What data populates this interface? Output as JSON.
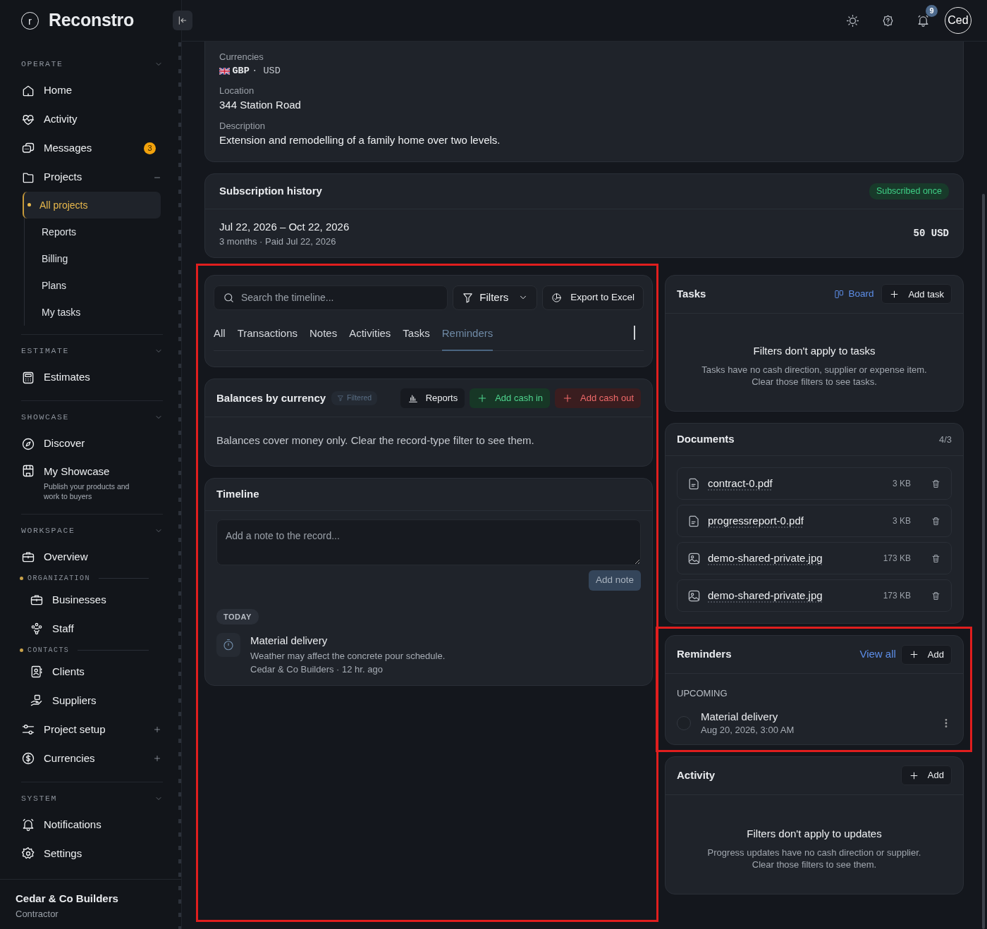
{
  "brand": {
    "mark": "r",
    "name": "Reconstro"
  },
  "topbar": {
    "notifications_count": "9",
    "avatar_text": "Ced"
  },
  "sidebar": {
    "sections": [
      {
        "title": "OPERATE",
        "expanded": true,
        "items": [
          {
            "label": "Home",
            "selected": false
          },
          {
            "label": "Activity",
            "selected": false
          },
          {
            "label": "Messages",
            "selected": false,
            "badge": "3"
          },
          {
            "label": "Projects",
            "selected": false,
            "expanded": true,
            "children": [
              {
                "label": "All projects",
                "selected": true
              },
              {
                "label": "Reports",
                "selected": false
              },
              {
                "label": "Billing",
                "selected": false
              },
              {
                "label": "Plans",
                "selected": false
              },
              {
                "label": "My tasks",
                "selected": false
              }
            ]
          }
        ]
      },
      {
        "title": "ESTIMATE",
        "expanded": true,
        "items": [
          {
            "label": "Estimates",
            "selected": false
          }
        ]
      },
      {
        "title": "SHOWCASE",
        "expanded": true,
        "items": [
          {
            "label": "Discover",
            "selected": false
          },
          {
            "label": "My Showcase",
            "selected": false,
            "description": "Publish your products and work to buyers"
          }
        ]
      },
      {
        "title": "WORKSPACE",
        "expanded": true,
        "items": [
          {
            "label": "Overview",
            "selected": false
          },
          {
            "kind": "group",
            "label": "ORGANIZATION",
            "children": [
              {
                "label": "Businesses",
                "selected": false
              },
              {
                "label": "Staff",
                "selected": false
              }
            ]
          },
          {
            "kind": "group",
            "label": "CONTACTS",
            "children": [
              {
                "label": "Clients",
                "selected": false
              },
              {
                "label": "Suppliers",
                "selected": false
              }
            ]
          },
          {
            "label": "Project setup",
            "selected": false,
            "expanded": false
          },
          {
            "label": "Currencies",
            "selected": false,
            "expanded": false
          }
        ]
      },
      {
        "title": "SYSTEM",
        "expanded": true,
        "items": [
          {
            "label": "Notifications",
            "selected": false
          },
          {
            "label": "Settings",
            "selected": false
          }
        ]
      }
    ],
    "footer": {
      "name": "Cedar & Co Builders",
      "role": "Contractor"
    }
  },
  "details": {
    "fields": [
      {
        "kind": "currency",
        "label": "Currencies",
        "value": "GBP",
        "extra": "· USD"
      },
      {
        "kind": "text",
        "label": "Location",
        "value": "344 Station Road"
      },
      {
        "kind": "text",
        "label": "Description",
        "value": "Extension and remodelling of a family home over two levels."
      }
    ]
  },
  "subscription": {
    "title": "Subscription history",
    "badge": "Subscribed once",
    "period": "Jul 22, 2026 – Oct 22, 2026",
    "meta": "3 months · Paid Jul 22, 2026",
    "amount": "50 USD"
  },
  "timeline_panel": {
    "highlighted": true,
    "search": {
      "placeholder": "Search the timeline..."
    },
    "filters_button": "Filters",
    "export_button": "Export to Excel",
    "tabs": [
      {
        "label": "All",
        "selected": false
      },
      {
        "label": "Transactions",
        "selected": false
      },
      {
        "label": "Notes",
        "selected": false
      },
      {
        "label": "Activities",
        "selected": false
      },
      {
        "label": "Tasks",
        "selected": false
      },
      {
        "label": "Reminders",
        "selected": true
      }
    ],
    "balances": {
      "title": "Balances by currency",
      "filter_badge": "Filtered",
      "buttons": [
        {
          "kind": "reports",
          "label": "Reports"
        },
        {
          "kind": "cash_in",
          "label": "Add cash in"
        },
        {
          "kind": "cash_out",
          "label": "Add cash out"
        }
      ],
      "message": "Balances cover money only. Clear the record-type filter to see them."
    },
    "timeline": {
      "title": "Timeline",
      "note": {
        "placeholder": "Add a note to the record..."
      },
      "add_note_button": "Add note",
      "add_note_disabled": true,
      "groups": [
        {
          "label": "TODAY",
          "entries": [
            {
              "title": "Material delivery",
              "text": "Weather may affect the concrete pour schedule.",
              "meta": "Cedar & Co Builders · 12 hr. ago"
            }
          ]
        }
      ]
    }
  },
  "tasks": {
    "title": "Tasks",
    "board_link": "Board",
    "add_button": "Add task",
    "empty_title": "Filters don't apply to tasks",
    "empty_text": "Tasks have no cash direction, supplier or expense item. Clear those filters to see tasks."
  },
  "documents": {
    "title": "Documents",
    "count": "4/3",
    "files": [
      {
        "kind": "pdf",
        "name": "contract-0.pdf",
        "size": "3 KB"
      },
      {
        "kind": "pdf",
        "name": "progressreport-0.pdf",
        "size": "3 KB"
      },
      {
        "kind": "image",
        "name": "demo-shared-private.jpg",
        "size": "173 KB"
      },
      {
        "kind": "image",
        "name": "demo-shared-private.jpg",
        "size": "173 KB"
      }
    ]
  },
  "reminders": {
    "highlighted": true,
    "title": "Reminders",
    "view_all": "View all",
    "add_button": "Add",
    "group": "UPCOMING",
    "items": [
      {
        "title": "Material delivery",
        "date": "Aug 20, 2026, 3:00 AM",
        "done": false
      }
    ]
  },
  "activity": {
    "title": "Activity",
    "add_button": "Add",
    "empty_title": "Filters don't apply to updates",
    "empty_text": "Progress updates have no cash direction or supplier. Clear those filters to see them."
  }
}
